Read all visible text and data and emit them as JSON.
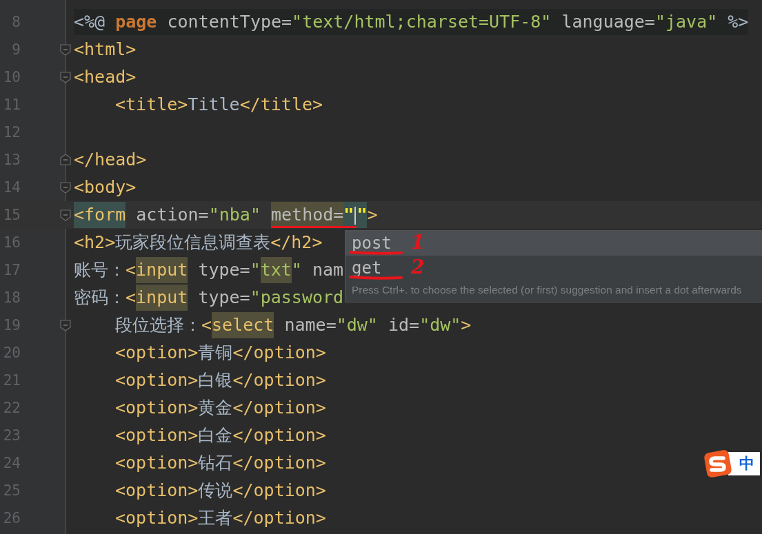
{
  "editor": {
    "lines": [
      {
        "number": "8",
        "kind": "directive",
        "fold_start": false,
        "fold_end": false,
        "indented": false,
        "current": false,
        "segments": [
          {
            "text": "<%@ ",
            "kind": "plain"
          },
          {
            "text": "page",
            "kind": "keyword"
          },
          {
            "text": " contentType=",
            "kind": "attr"
          },
          {
            "text": "\"text/html;charset=UTF-8\"",
            "kind": "string"
          },
          {
            "text": " language=",
            "kind": "attr"
          },
          {
            "text": "\"java\"",
            "kind": "string"
          },
          {
            "text": " %>",
            "kind": "plain"
          }
        ]
      },
      {
        "number": "9",
        "kind": "code",
        "fold_start": true,
        "fold_end": false,
        "indented": false,
        "current": false,
        "segments": [
          {
            "text": "<html>",
            "kind": "tag"
          }
        ]
      },
      {
        "number": "10",
        "kind": "code",
        "fold_start": true,
        "fold_end": false,
        "indented": false,
        "current": false,
        "segments": [
          {
            "text": "<head>",
            "kind": "tag"
          }
        ]
      },
      {
        "number": "11",
        "kind": "code",
        "fold_start": false,
        "fold_end": false,
        "indented": true,
        "current": false,
        "segments": [
          {
            "text": "<title>",
            "kind": "tag"
          },
          {
            "text": "Title",
            "kind": "text"
          },
          {
            "text": "</title>",
            "kind": "tag"
          }
        ]
      },
      {
        "number": "12",
        "kind": "code",
        "fold_start": false,
        "fold_end": false,
        "current": false
      },
      {
        "number": "13",
        "kind": "code",
        "fold_start": false,
        "fold_end": true,
        "indented": false,
        "current": false,
        "segments": [
          {
            "text": "</head>",
            "kind": "tag"
          }
        ]
      },
      {
        "number": "14",
        "kind": "code",
        "fold_start": true,
        "fold_end": false,
        "indented": false,
        "current": false,
        "segments": [
          {
            "text": "<body>",
            "kind": "tag"
          }
        ]
      },
      {
        "number": "15",
        "kind": "code",
        "fold_start": true,
        "fold_end": false,
        "indented": false,
        "current": true,
        "segments": [
          {
            "text": "<form",
            "kind": "tag",
            "matched": true
          },
          {
            "text": " action=",
            "kind": "attr"
          },
          {
            "text": "\"nba\" ",
            "kind": "string"
          },
          {
            "text": "method=",
            "kind": "attr",
            "usage": true,
            "underlined": true
          },
          {
            "text": "\"",
            "kind": "quote",
            "matched": true,
            "underlined": true,
            "caret_after": true
          },
          {
            "text": "\"",
            "kind": "quote",
            "matched": true
          },
          {
            "text": ">",
            "kind": "tag"
          }
        ]
      },
      {
        "number": "16",
        "kind": "code",
        "fold_start": false,
        "fold_end": false,
        "indented": false,
        "current": false,
        "segments": [
          {
            "text": "<h2>",
            "kind": "tag"
          },
          {
            "text": "玩家段位信息调查表",
            "kind": "text"
          },
          {
            "text": "</h2>",
            "kind": "tag"
          }
        ]
      },
      {
        "number": "17",
        "kind": "code",
        "fold_start": false,
        "fold_end": false,
        "indented": false,
        "current": false,
        "segments": [
          {
            "text": "账号：",
            "kind": "text"
          },
          {
            "text": "<",
            "kind": "tag"
          },
          {
            "text": "input",
            "kind": "tag",
            "usage": true
          },
          {
            "text": " type=",
            "kind": "attr"
          },
          {
            "text": "\"",
            "kind": "string"
          },
          {
            "text": "txt",
            "kind": "string",
            "usage": true
          },
          {
            "text": "\"",
            "kind": "string"
          },
          {
            "text": " nam",
            "kind": "attr"
          }
        ]
      },
      {
        "number": "18",
        "kind": "code",
        "fold_start": false,
        "fold_end": false,
        "indented": false,
        "current": false,
        "segments": [
          {
            "text": "密码：",
            "kind": "text"
          },
          {
            "text": "<",
            "kind": "tag"
          },
          {
            "text": "input",
            "kind": "tag",
            "usage": true
          },
          {
            "text": " type=",
            "kind": "attr"
          },
          {
            "text": "\"password",
            "kind": "string"
          }
        ]
      },
      {
        "number": "19",
        "kind": "code",
        "fold_start": true,
        "fold_end": false,
        "indented": true,
        "current": false,
        "segments": [
          {
            "text": "段位选择：",
            "kind": "text"
          },
          {
            "text": "<",
            "kind": "tag"
          },
          {
            "text": "select",
            "kind": "tag",
            "usage": true
          },
          {
            "text": " name=",
            "kind": "attr"
          },
          {
            "text": "\"dw\"",
            "kind": "string"
          },
          {
            "text": " id=",
            "kind": "attr"
          },
          {
            "text": "\"dw\"",
            "kind": "string"
          },
          {
            "text": ">",
            "kind": "tag"
          }
        ]
      },
      {
        "number": "20",
        "kind": "code",
        "fold_start": false,
        "fold_end": false,
        "indented": true,
        "current": false,
        "segments": [
          {
            "text": "<option>",
            "kind": "tag"
          },
          {
            "text": "青铜",
            "kind": "text"
          },
          {
            "text": "</option>",
            "kind": "tag"
          }
        ]
      },
      {
        "number": "21",
        "kind": "code",
        "fold_start": false,
        "fold_end": false,
        "indented": true,
        "current": false,
        "segments": [
          {
            "text": "<option>",
            "kind": "tag"
          },
          {
            "text": "白银",
            "kind": "text"
          },
          {
            "text": "</option>",
            "kind": "tag"
          }
        ]
      },
      {
        "number": "22",
        "kind": "code",
        "fold_start": false,
        "fold_end": false,
        "indented": true,
        "current": false,
        "segments": [
          {
            "text": "<option>",
            "kind": "tag"
          },
          {
            "text": "黄金",
            "kind": "text"
          },
          {
            "text": "</option>",
            "kind": "tag"
          }
        ]
      },
      {
        "number": "23",
        "kind": "code",
        "fold_start": false,
        "fold_end": false,
        "indented": true,
        "current": false,
        "segments": [
          {
            "text": "<option>",
            "kind": "tag"
          },
          {
            "text": "白金",
            "kind": "text"
          },
          {
            "text": "</option>",
            "kind": "tag"
          }
        ]
      },
      {
        "number": "24",
        "kind": "code",
        "fold_start": false,
        "fold_end": false,
        "indented": true,
        "current": false,
        "segments": [
          {
            "text": "<option>",
            "kind": "tag"
          },
          {
            "text": "钻石",
            "kind": "text"
          },
          {
            "text": "</option>",
            "kind": "tag"
          }
        ]
      },
      {
        "number": "25",
        "kind": "code",
        "fold_start": false,
        "fold_end": false,
        "indented": true,
        "current": false,
        "segments": [
          {
            "text": "<option>",
            "kind": "tag"
          },
          {
            "text": "传说",
            "kind": "text"
          },
          {
            "text": "</option>",
            "kind": "tag"
          }
        ]
      },
      {
        "number": "26",
        "kind": "code",
        "fold_start": false,
        "fold_end": false,
        "indented": true,
        "current": false,
        "segments": [
          {
            "text": "<option>",
            "kind": "tag"
          },
          {
            "text": "王者",
            "kind": "text"
          },
          {
            "text": "</option>",
            "kind": "tag"
          }
        ]
      }
    ]
  },
  "completion_popup": {
    "items": [
      {
        "label": "post",
        "selected": true,
        "underlined": true,
        "note": "1"
      },
      {
        "label": "get",
        "selected": false,
        "underlined": true,
        "note": "2"
      }
    ],
    "hint": "Press Ctrl+. to choose the selected (or first) suggestion and insert a dot afterwards"
  },
  "ime": {
    "mode": "中"
  }
}
